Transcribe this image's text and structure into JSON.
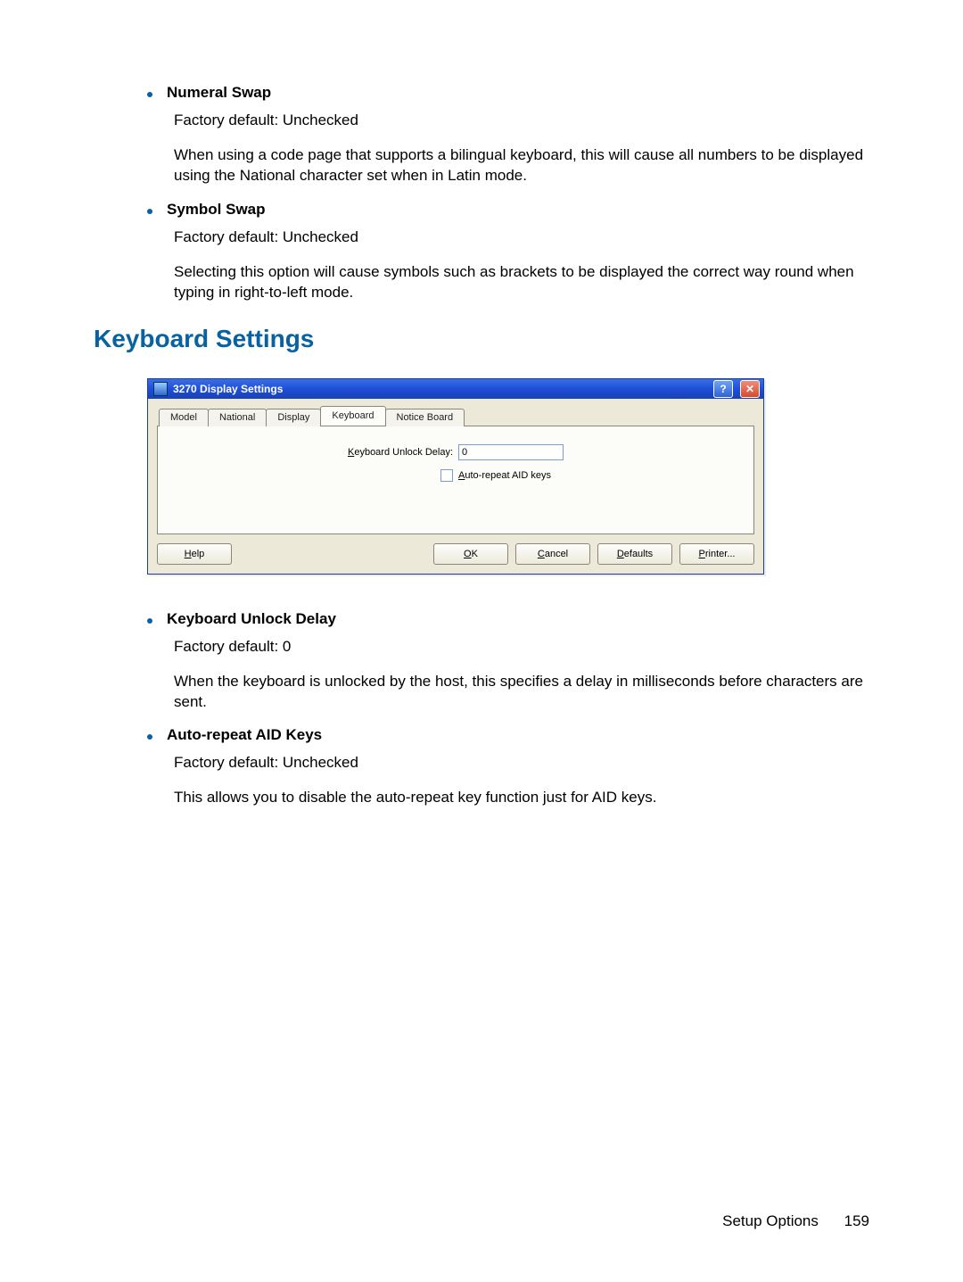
{
  "section1": {
    "items": [
      {
        "title": "Numeral Swap",
        "default": "Factory default: Unchecked",
        "desc": "When using a code page that supports a bilingual keyboard, this will cause all numbers to be displayed using the National character set when in Latin mode."
      },
      {
        "title": "Symbol Swap",
        "default": "Factory default: Unchecked",
        "desc": "Selecting this option will cause symbols such as brackets to be displayed the correct way round when typing in right-to-left mode."
      }
    ]
  },
  "heading": "Keyboard Settings",
  "dialog": {
    "title": "3270 Display Settings",
    "tabs": [
      "Model",
      "National",
      "Display",
      "Keyboard",
      "Notice Board"
    ],
    "active_tab_index": 3,
    "field_label": "Keyboard Unlock Delay:",
    "field_label_ul": "K",
    "field_value": "0",
    "checkbox_label": "Auto-repeat AID keys",
    "checkbox_label_ul": "A",
    "buttons": {
      "help": "Help",
      "ok": "OK",
      "cancel": "Cancel",
      "defaults": "Defaults",
      "printer": "Printer..."
    }
  },
  "section2": {
    "items": [
      {
        "title": "Keyboard Unlock Delay",
        "default": "Factory default: 0",
        "desc": "When the keyboard is unlocked by the host, this specifies a delay in milliseconds before characters are sent."
      },
      {
        "title": "Auto-repeat AID Keys",
        "default": "Factory default: Unchecked",
        "desc": "This allows you to disable the auto-repeat key function just for AID keys."
      }
    ]
  },
  "footer": {
    "section": "Setup Options",
    "page": "159"
  }
}
